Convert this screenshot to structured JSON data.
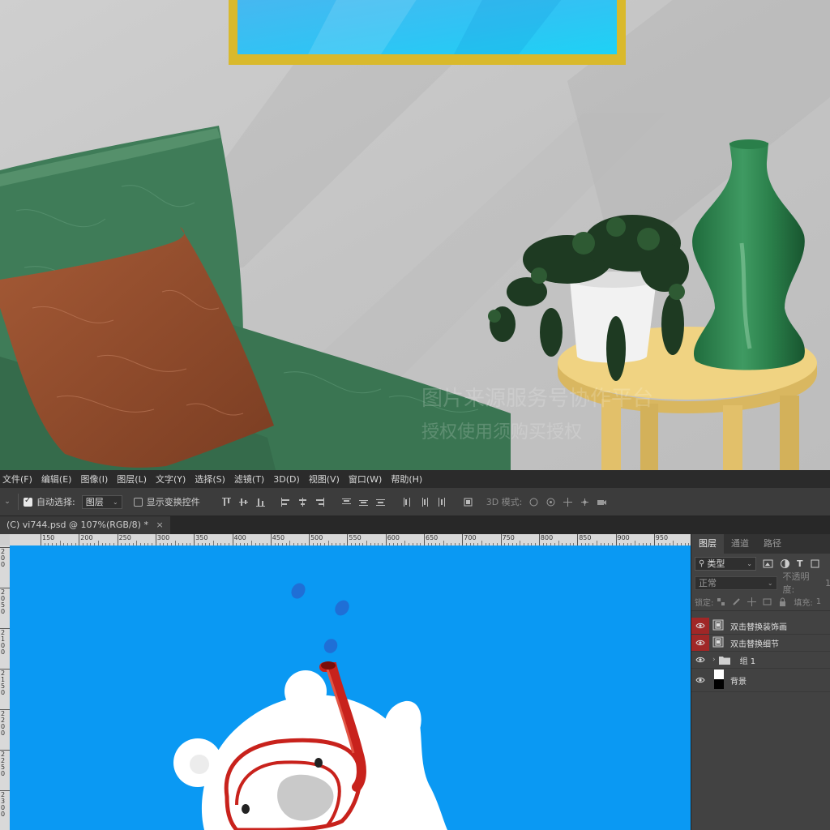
{
  "watermark": {
    "line1": "图片来源服务号协作平台",
    "line2": "授权使用须购买授权"
  },
  "menubar": {
    "items": [
      "文件(F)",
      "编辑(E)",
      "图像(I)",
      "图层(L)",
      "文字(Y)",
      "选择(S)",
      "滤镜(T)",
      "3D(D)",
      "视图(V)",
      "窗口(W)",
      "帮助(H)"
    ]
  },
  "options": {
    "auto_select_label": "自动选择:",
    "auto_select_checked": true,
    "target_value": "图层",
    "show_transform_label": "显示变换控件",
    "show_transform_checked": false,
    "mode_3d_label": "3D 模式:"
  },
  "document": {
    "tab_title": "(C) vi744.psd @ 107%(RGB/8) *",
    "close_glyph": "×"
  },
  "ruler": {
    "top_labels": [
      "150",
      "200",
      "250",
      "300",
      "350",
      "400",
      "450",
      "500",
      "550",
      "600",
      "650",
      "700",
      "750",
      "800",
      "850",
      "900",
      "950"
    ],
    "left_labels": [
      "2\n0\n0",
      "2\n0\n5\n0",
      "2\n1\n0\n0",
      "2\n1\n5\n0",
      "2\n2\n0\n0",
      "2\n2\n5\n0",
      "2\n3\n0\n0"
    ]
  },
  "layers_panel": {
    "tabs": [
      "图层",
      "通道",
      "路径"
    ],
    "active_tab": "图层",
    "filter_kind": "类型",
    "blend_mode": "正常",
    "opacity_label": "不透明度:",
    "opacity_value": "1",
    "lock_label": "锁定:",
    "fill_label": "填充:",
    "fill_value": "1",
    "layers": [
      {
        "name": "双击替换装饰画",
        "type": "smart-object",
        "eye_highlight": true
      },
      {
        "name": "双击替换细节",
        "type": "smart-object",
        "eye_highlight": true
      },
      {
        "name": "组 1",
        "type": "group",
        "eye_highlight": false
      },
      {
        "name": "背景",
        "type": "background",
        "eye_highlight": false
      }
    ]
  },
  "colors": {
    "canvas_bg": "#0a99f3",
    "menubar_bg": "#2b2b2b",
    "panel_bg": "#424242",
    "eye_highlight": "#a02727"
  }
}
